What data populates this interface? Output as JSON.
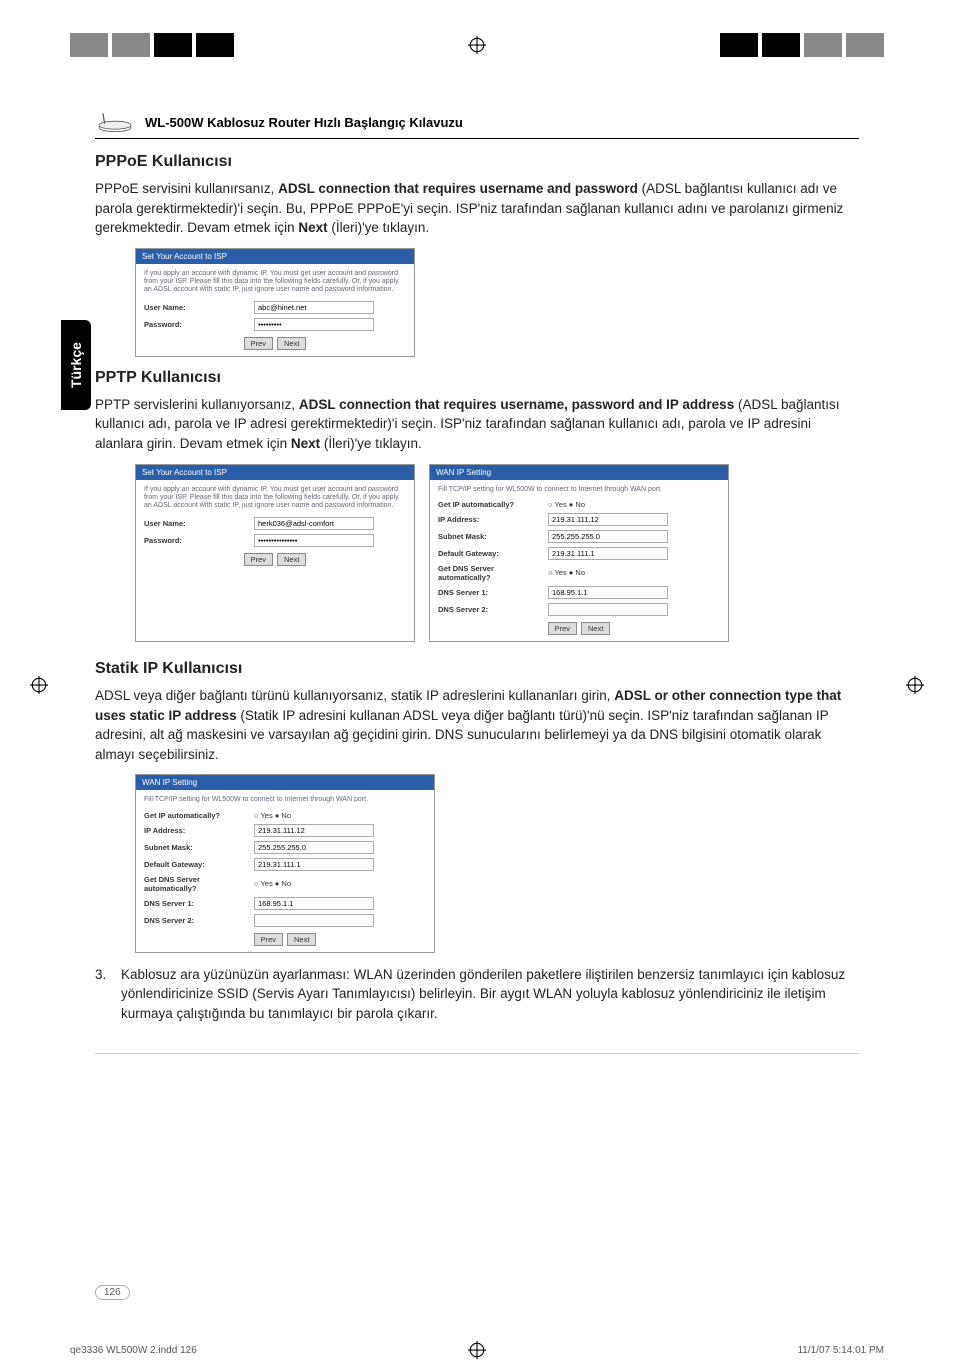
{
  "header": {
    "title": "WL-500W Kablosuz Router Hızlı Başlangıç Kılavuzu"
  },
  "sideTab": "Türkçe",
  "section1": {
    "title": "PPPoE Kullanıcısı",
    "paragraph_pre": "PPPoE servisini kullanırsanız, ",
    "bold1": "ADSL connection that requires username and password",
    "paragraph_mid": " (ADSL bağlantısı kullanıcı adı ve parola gerektirmektedir)'i seçin. Bu, PPPoE PPPoE'yi seçin. ISP'niz tarafından sağlanan kullanıcı adını ve parolanızı girmeniz gerekmektedir. Devam etmek için ",
    "bold2": "Next",
    "paragraph_post": " (İleri)'ye tıklayın."
  },
  "section2": {
    "title": "PPTP Kullanıcısı",
    "paragraph_pre": "PPTP servislerini kullanıyorsanız, ",
    "bold1": "ADSL connection that requires username, password and IP address",
    "paragraph_mid": " (ADSL bağlantısı kullanıcı adı, parola ve IP adresi gerektirmektedir)'i seçin. ISP'niz tarafından sağlanan kullanıcı adı, parola ve IP adresini alanlara girin. Devam etmek için ",
    "bold2": "Next",
    "paragraph_post": " (İleri)'ye tıklayın."
  },
  "section3": {
    "title": "Statik IP Kullanıcısı",
    "paragraph_pre": "ADSL veya diğer bağlantı türünü kullanıyorsanız, statik IP adreslerini kullananları girin, ",
    "bold1": "ADSL or other connection type that uses static IP address",
    "paragraph_post": " (Statik IP adresini kullanan ADSL veya diğer bağlantı türü)'nü seçin. ISP'niz tarafından sağlanan IP adresini, alt ağ maskesini ve varsayılan ağ geçidini girin. DNS sunucularını belirlemeyi ya da DNS bilgisini otomatik olarak almayı seçebilirsiniz."
  },
  "listItem": {
    "num": "3.",
    "text": "Kablosuz ara yüzünüzün ayarlanması: WLAN üzerinden gönderilen paketlere iliştirilen benzersiz tanımlayıcı için kablosuz yönlendiricinize SSID (Servis Ayarı Tanımlayıcısı) belirleyin. Bir aygıt WLAN yoluyla kablosuz yönlendiriciniz ile iletişim kurmaya çalıştığında bu tanımlayıcı bir parola çıkarır."
  },
  "shot1": {
    "header": "Set Your Account to ISP",
    "desc": "If you apply an account with dynamic IP, You must get user account and password from your ISP. Please fill this data into the following fields carefully. Or, if you apply an ADSL account with static IP, just ignore user name and password information.",
    "userLabel": "User Name:",
    "userVal": "abc@hinet.net",
    "passLabel": "Password:",
    "passVal": "•••••••••",
    "prev": "Prev",
    "next": "Next"
  },
  "shot2": {
    "header": "Set Your Account to ISP",
    "desc": "If you apply an account with dynamic IP, You must get user account and password from your ISP. Please fill this data into the following fields carefully. Or, if you apply an ADSL account with static IP, just ignore user name and password information.",
    "userLabel": "User Name:",
    "userVal": "herk036@adsl-comfort",
    "passLabel": "Password:",
    "passVal": "•••••••••••••••",
    "prev": "Prev",
    "next": "Next"
  },
  "shot3": {
    "header": "WAN IP Setting",
    "desc": "Fill TCP/IP setting for WL500W to connect to Internet through WAN port.",
    "rows": {
      "r1l": "Get IP automatically?",
      "r1v": "○ Yes  ● No",
      "r2l": "IP Address:",
      "r2v": "219.31.111.12",
      "r3l": "Subnet Mask:",
      "r3v": "255.255.255.0",
      "r4l": "Default Gateway:",
      "r4v": "219.31.111.1",
      "r5l": "Get DNS Server automatically?",
      "r5v": "○ Yes  ● No",
      "r6l": "DNS Server 1:",
      "r6v": "168.95.1.1",
      "r7l": "DNS Server 2:",
      "r7v": ""
    },
    "prev": "Prev",
    "next": "Next"
  },
  "shot4": {
    "header": "WAN IP Setting",
    "desc": "Fill TCP/IP setting for WL500W to connect to Internet through WAN port.",
    "rows": {
      "r1l": "Get IP automatically?",
      "r1v": "○ Yes  ● No",
      "r2l": "IP Address:",
      "r2v": "219.31.111.12",
      "r3l": "Subnet Mask:",
      "r3v": "255.255.255.0",
      "r4l": "Default Gateway:",
      "r4v": "219.31.111.1",
      "r5l": "Get DNS Server automatically?",
      "r5v": "○ Yes  ● No",
      "r6l": "DNS Server 1:",
      "r6v": "168.95.1.1",
      "r7l": "DNS Server 2:",
      "r7v": ""
    },
    "prev": "Prev",
    "next": "Next"
  },
  "pageNum": "126",
  "footer": {
    "left": "qe3336 WL500W 2.indd   126",
    "right": "11/1/07   5:14:01 PM"
  }
}
